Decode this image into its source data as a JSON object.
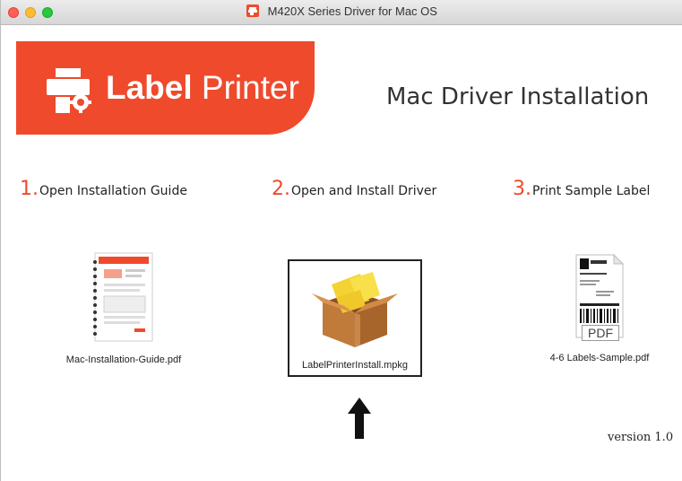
{
  "window": {
    "title": "M420X Series Driver for Mac OS"
  },
  "banner": {
    "logo_bold": "Label",
    "logo_light": " Printer",
    "brand_color": "#ef4a2c"
  },
  "main": {
    "heading": "Mac Driver Installation",
    "steps": [
      {
        "number": "1.",
        "label": "Open Installation Guide"
      },
      {
        "number": "2.",
        "label": "Open and Install Driver"
      },
      {
        "number": "3.",
        "label": "Print Sample Label"
      }
    ],
    "files": [
      {
        "name": "Mac-Installation-Guide.pdf",
        "icon": "document-icon"
      },
      {
        "name": "LabelPrinterInstall.mpkg",
        "icon": "package-icon"
      },
      {
        "name": "4-6 Labels-Sample.pdf",
        "icon": "pdf-label-icon"
      }
    ],
    "pdf_badge": "PDF",
    "version": "version 1.0"
  }
}
